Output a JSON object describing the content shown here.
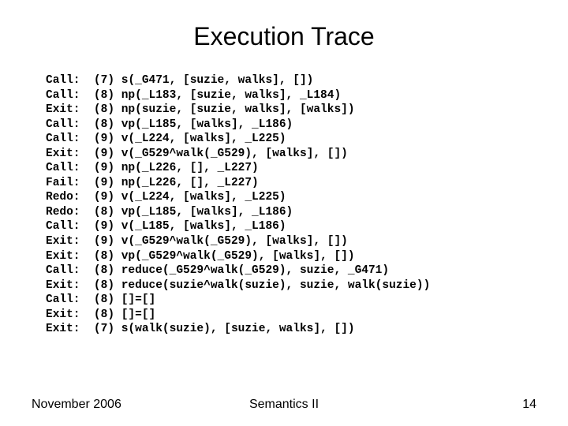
{
  "title": "Execution Trace",
  "trace": [
    {
      "event": "Call:",
      "level": "(7)",
      "goal": "s(_G471, [suzie, walks], [])"
    },
    {
      "event": "Call:",
      "level": "(8)",
      "goal": "np(_L183, [suzie, walks], _L184)"
    },
    {
      "event": "Exit:",
      "level": "(8)",
      "goal": "np(suzie, [suzie, walks], [walks])"
    },
    {
      "event": "Call:",
      "level": "(8)",
      "goal": "vp(_L185, [walks], _L186)"
    },
    {
      "event": "Call:",
      "level": "(9)",
      "goal": "v(_L224, [walks], _L225)"
    },
    {
      "event": "Exit:",
      "level": "(9)",
      "goal": "v(_G529^walk(_G529), [walks], [])"
    },
    {
      "event": "Call:",
      "level": "(9)",
      "goal": "np(_L226, [], _L227)"
    },
    {
      "event": "Fail:",
      "level": "(9)",
      "goal": "np(_L226, [], _L227)"
    },
    {
      "event": "Redo:",
      "level": "(9)",
      "goal": "v(_L224, [walks], _L225)"
    },
    {
      "event": "Redo:",
      "level": "(8)",
      "goal": "vp(_L185, [walks], _L186)"
    },
    {
      "event": "Call:",
      "level": "(9)",
      "goal": "v(_L185, [walks], _L186)"
    },
    {
      "event": "Exit:",
      "level": "(9)",
      "goal": "v(_G529^walk(_G529), [walks], [])"
    },
    {
      "event": "Exit:",
      "level": "(8)",
      "goal": "vp(_G529^walk(_G529), [walks], [])"
    },
    {
      "event": "Call:",
      "level": "(8)",
      "goal": "reduce(_G529^walk(_G529), suzie, _G471)"
    },
    {
      "event": "Exit:",
      "level": "(8)",
      "goal": "reduce(suzie^walk(suzie), suzie, walk(suzie))"
    },
    {
      "event": "Call:",
      "level": "(8)",
      "goal": "[]=[]"
    },
    {
      "event": "Exit:",
      "level": "(8)",
      "goal": "[]=[]"
    },
    {
      "event": "Exit:",
      "level": "(7)",
      "goal": "s(walk(suzie), [suzie, walks], [])"
    }
  ],
  "footer": {
    "left": "November 2006",
    "center": "Semantics II",
    "right": "14"
  }
}
